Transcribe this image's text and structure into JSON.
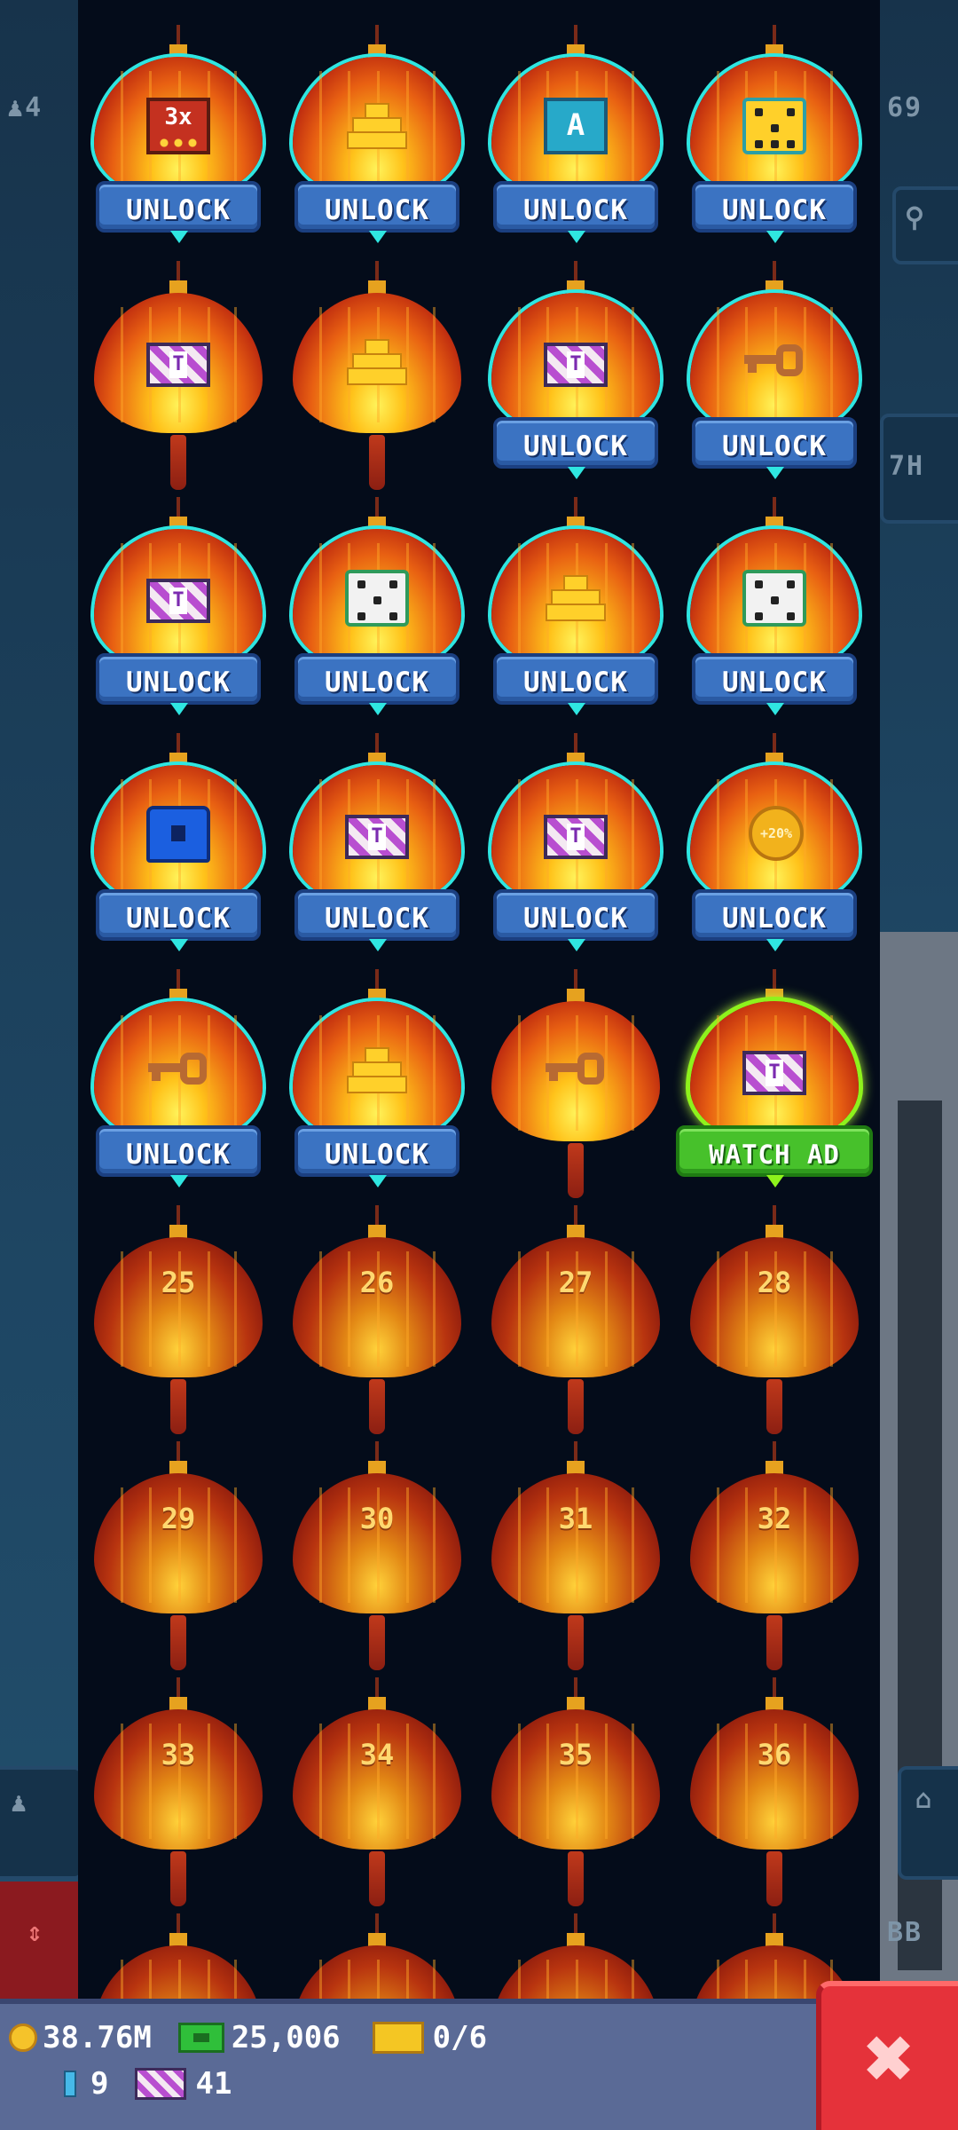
{
  "side_left": {
    "top_counter": "4",
    "level_marker": ""
  },
  "side_right": {
    "top_counter": "69",
    "time_label": "7H",
    "bottom_label": "BB"
  },
  "lanterns": [
    {
      "reward": "mult-3x",
      "reward_text": "3x",
      "state": "locked",
      "button": "UNLOCK"
    },
    {
      "reward": "gold-bars",
      "state": "locked",
      "button": "UNLOCK"
    },
    {
      "reward": "reset-card",
      "reward_text": "A",
      "state": "locked",
      "button": "UNLOCK"
    },
    {
      "reward": "dice-gold",
      "state": "locked",
      "button": "UNLOCK"
    },
    {
      "reward": "ticket",
      "reward_text": "T",
      "state": "claimed",
      "button": ""
    },
    {
      "reward": "gold-bars",
      "state": "claimed",
      "button": ""
    },
    {
      "reward": "ticket",
      "reward_text": "T",
      "state": "locked",
      "button": "UNLOCK"
    },
    {
      "reward": "key",
      "state": "locked",
      "button": "UNLOCK"
    },
    {
      "reward": "ticket",
      "reward_text": "T",
      "state": "locked",
      "button": "UNLOCK"
    },
    {
      "reward": "dice-white",
      "state": "locked",
      "button": "UNLOCK"
    },
    {
      "reward": "gold-bars",
      "state": "locked",
      "button": "UNLOCK"
    },
    {
      "reward": "dice-white",
      "state": "locked",
      "button": "UNLOCK"
    },
    {
      "reward": "chest",
      "state": "locked",
      "button": "UNLOCK"
    },
    {
      "reward": "ticket",
      "reward_text": "T",
      "state": "locked",
      "button": "UNLOCK"
    },
    {
      "reward": "ticket",
      "reward_text": "T",
      "state": "locked",
      "button": "UNLOCK"
    },
    {
      "reward": "coin-boost",
      "reward_text": "+20%",
      "state": "locked",
      "button": "UNLOCK"
    },
    {
      "reward": "key",
      "state": "locked",
      "button": "UNLOCK"
    },
    {
      "reward": "gold-bars",
      "state": "locked",
      "button": "UNLOCK"
    },
    {
      "reward": "key",
      "state": "claimed",
      "button": ""
    },
    {
      "reward": "ticket",
      "reward_text": "T",
      "state": "ad",
      "button": "WATCH AD"
    },
    {
      "number": "25",
      "state": "future"
    },
    {
      "number": "26",
      "state": "future"
    },
    {
      "number": "27",
      "state": "future"
    },
    {
      "number": "28",
      "state": "future"
    },
    {
      "number": "29",
      "state": "future"
    },
    {
      "number": "30",
      "state": "future"
    },
    {
      "number": "31",
      "state": "future"
    },
    {
      "number": "32",
      "state": "future"
    },
    {
      "number": "33",
      "state": "future"
    },
    {
      "number": "34",
      "state": "future"
    },
    {
      "number": "35",
      "state": "future"
    },
    {
      "number": "36",
      "state": "future"
    },
    {
      "number": "",
      "state": "future"
    },
    {
      "number": "",
      "state": "future"
    },
    {
      "number": "",
      "state": "future"
    },
    {
      "number": "",
      "state": "future"
    }
  ],
  "hud": {
    "coins": "38.76M",
    "cash": "25,006",
    "gold_tickets": "0/6",
    "gems": "9",
    "tickets": "41"
  },
  "colors": {
    "panel_bg": "#040c1a",
    "unlock_button": "#3b73c2",
    "watch_ad_button": "#47c12b",
    "glow": "#2fe6e1",
    "close_button": "#e5323a"
  },
  "icons": {
    "close": "close-x-icon"
  }
}
